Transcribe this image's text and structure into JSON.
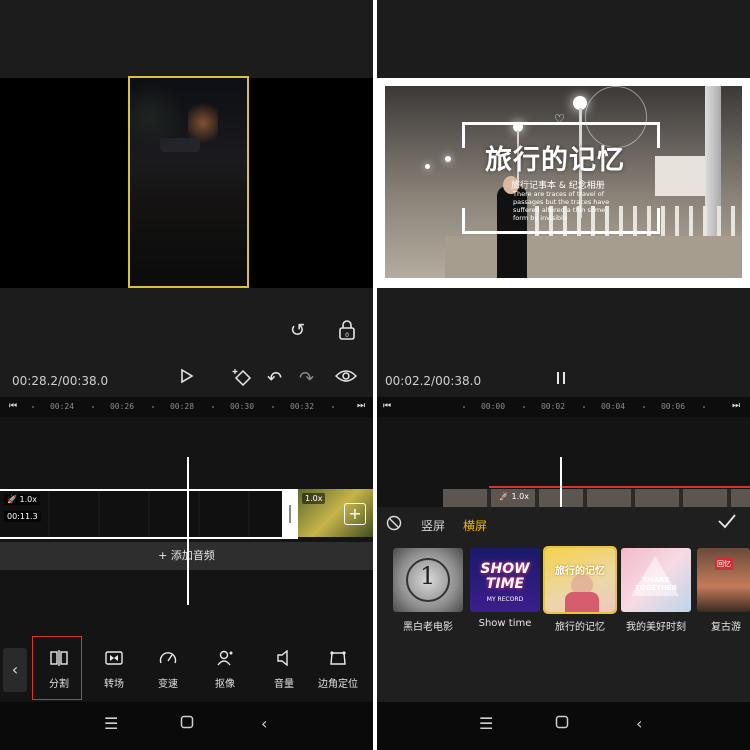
{
  "left": {
    "time_display": "00:28.2/00:38.0",
    "timeline_ticks": [
      "00:24",
      "00:26",
      "00:28",
      "00:30",
      "00:32"
    ],
    "clip_speed": "1.0x",
    "clip_duration": "00:11.3",
    "next_clip_speed": "1.0x",
    "add_audio_label": "+ 添加音频",
    "tools": [
      {
        "label": "分割",
        "icon": "split-icon"
      },
      {
        "label": "转场",
        "icon": "transition-icon"
      },
      {
        "label": "变速",
        "icon": "speed-icon"
      },
      {
        "label": "抠像",
        "icon": "cutout-icon"
      },
      {
        "label": "音量",
        "icon": "volume-icon"
      },
      {
        "label": "边角定位",
        "icon": "corner-pin-icon"
      }
    ]
  },
  "right": {
    "time_display": "00:02.2/00:38.0",
    "timeline_ticks": [
      "00:00",
      "00:02",
      "00:04",
      "00:06"
    ],
    "clip_speed": "1.0x",
    "video_title": "旅行的记忆",
    "video_subtitle": "旅行记事本 & 纪念相册",
    "video_body": "There are traces of travel of passages but the traces have suffered altered a thin some form by invisible",
    "orientation_tabs": [
      "竖屏",
      "横屏"
    ],
    "active_tab": "横屏",
    "templates": [
      {
        "name": "黑白老电影",
        "thumb_text": "1"
      },
      {
        "name": "Show time",
        "thumb_text": "SHOW TIME",
        "thumb_subtext": "MY RECORD"
      },
      {
        "name": "旅行的记忆",
        "thumb_text": "旅行的记忆"
      },
      {
        "name": "我的美好时刻",
        "thumb_text": "SHARE TOGETHER"
      },
      {
        "name": "复古游",
        "thumb_text": "回忆"
      }
    ],
    "colors": {
      "accent": "#f2b600",
      "selection": "#e8c53a",
      "highlight_box": "#d9342b"
    }
  }
}
